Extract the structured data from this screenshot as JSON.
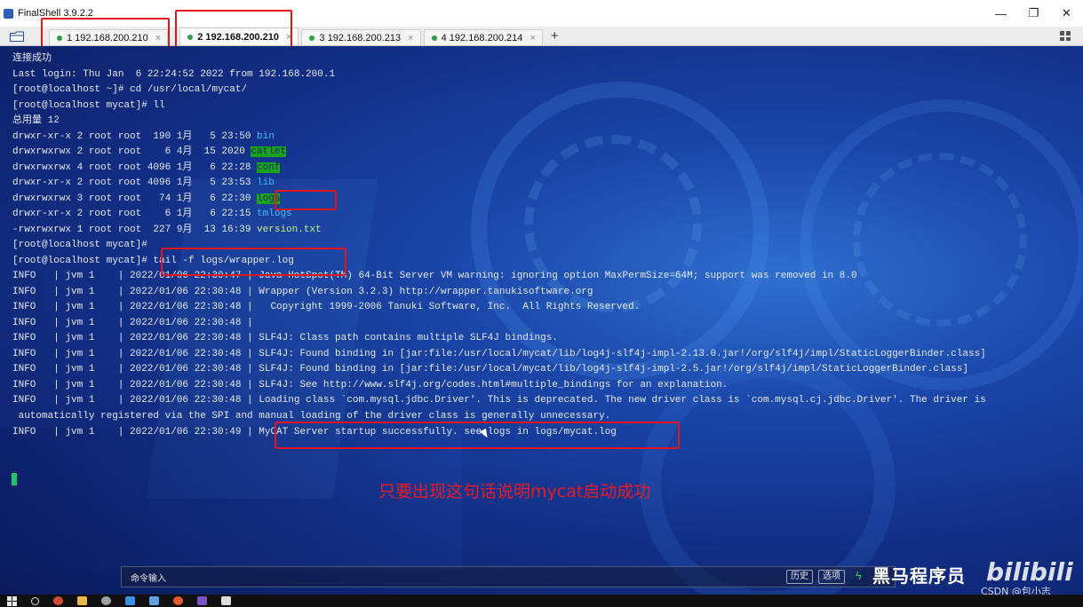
{
  "window": {
    "title": "FinalShell 3.9.2.2",
    "minimize": "—",
    "maximize": "❐",
    "close": "✕"
  },
  "tabs": [
    {
      "label": "1 192.168.200.210",
      "close": "×",
      "active": false,
      "highlighted": true
    },
    {
      "label": "2 192.168.200.210",
      "close": "×",
      "active": true,
      "highlighted": true
    },
    {
      "label": "3 192.168.200.213",
      "close": "×",
      "active": false,
      "highlighted": false
    },
    {
      "label": "4 192.168.200.214",
      "close": "×",
      "active": false,
      "highlighted": false
    }
  ],
  "add_tab": "+",
  "terminal": {
    "lines": [
      {
        "text": "连接成功"
      },
      {
        "text": "Last login: Thu Jan  6 22:24:52 2022 from 192.168.200.1"
      },
      {
        "text": "[root@localhost ~]# cd /usr/local/mycat/"
      },
      {
        "text": "[root@localhost mycat]# ll"
      },
      {
        "text": "总用量 12"
      },
      {
        "text": "drwxr-xr-x 2 root root  190 1月   5 23:50 ",
        "name": "bin",
        "style": "dir"
      },
      {
        "text": "drwxrwxrwx 2 root root    6 4月  15 2020 ",
        "name": "catlet",
        "style": "greenbg"
      },
      {
        "text": "drwxrwxrwx 4 root root 4096 1月   6 22:28 ",
        "name": "conf",
        "style": "greenbg"
      },
      {
        "text": "drwxr-xr-x 2 root root 4096 1月   5 23:53 ",
        "name": "lib",
        "style": "dir"
      },
      {
        "text": "drwxrwxrwx 3 root root   74 1月   6 22:30 ",
        "name": "logs",
        "style": "greenbg"
      },
      {
        "text": "drwxr-xr-x 2 root root    6 1月   6 22:15 ",
        "name": "tmlogs",
        "style": "dir"
      },
      {
        "text": "-rwxrwxrwx 1 root root  227 9月  13 16:39 ",
        "name": "version.txt",
        "style": "plain"
      },
      {
        "text": "[root@localhost mycat]# "
      },
      {
        "text": "[root@localhost mycat]# tail -f logs/wrapper.log"
      },
      {
        "text": "INFO   | jvm 1    | 2022/01/06 22:30:47 | Java HotSpot(TM) 64-Bit Server VM warning: ignoring option MaxPermSize=64M; support was removed in 8.0"
      },
      {
        "text": "INFO   | jvm 1    | 2022/01/06 22:30:48 | Wrapper (Version 3.2.3) http://wrapper.tanukisoftware.org"
      },
      {
        "text": "INFO   | jvm 1    | 2022/01/06 22:30:48 |   Copyright 1999-2006 Tanuki Software, Inc.  All Rights Reserved."
      },
      {
        "text": "INFO   | jvm 1    | 2022/01/06 22:30:48 |"
      },
      {
        "text": "INFO   | jvm 1    | 2022/01/06 22:30:48 | SLF4J: Class path contains multiple SLF4J bindings."
      },
      {
        "text": "INFO   | jvm 1    | 2022/01/06 22:30:48 | SLF4J: Found binding in [jar:file:/usr/local/mycat/lib/log4j-slf4j-impl-2.13.0.jar!/org/slf4j/impl/StaticLoggerBinder.class]"
      },
      {
        "text": "INFO   | jvm 1    | 2022/01/06 22:30:48 | SLF4J: Found binding in [jar:file:/usr/local/mycat/lib/log4j-slf4j-impl-2.5.jar!/org/slf4j/impl/StaticLoggerBinder.class]"
      },
      {
        "text": "INFO   | jvm 1    | 2022/01/06 22:30:48 | SLF4J: See http://www.slf4j.org/codes.html#multiple_bindings for an explanation."
      },
      {
        "text": "INFO   | jvm 1    | 2022/01/06 22:30:48 | Loading class `com.mysql.jdbc.Driver'. This is deprecated. The new driver class is `com.mysql.cj.jdbc.Driver'. The driver is"
      },
      {
        "text": " automatically registered via the SPI and manual loading of the driver class is generally unnecessary."
      },
      {
        "text": "INFO   | jvm 1    | 2022/01/06 22:30:49 | MyCAT Server startup successfully. see logs in logs/mycat.log"
      }
    ],
    "annotation": "只要出现这句话说明mycat启动成功"
  },
  "command_bar": {
    "label": "命令输入",
    "history_button": "历史",
    "options_button": "选项"
  },
  "overlay": {
    "brand": "黑马程序员",
    "brand2": "bilibili",
    "watermark": "CSDN @包小志"
  },
  "colors": {
    "highlight": "#e3141b",
    "green_bg": "#1aa31a",
    "terminal_text": "#e4e8f2",
    "annotation": "#ea1b22"
  },
  "icons": [
    "folder-icon",
    "grid-layout-icon",
    "bolt-icon",
    "windows-start-icon"
  ]
}
